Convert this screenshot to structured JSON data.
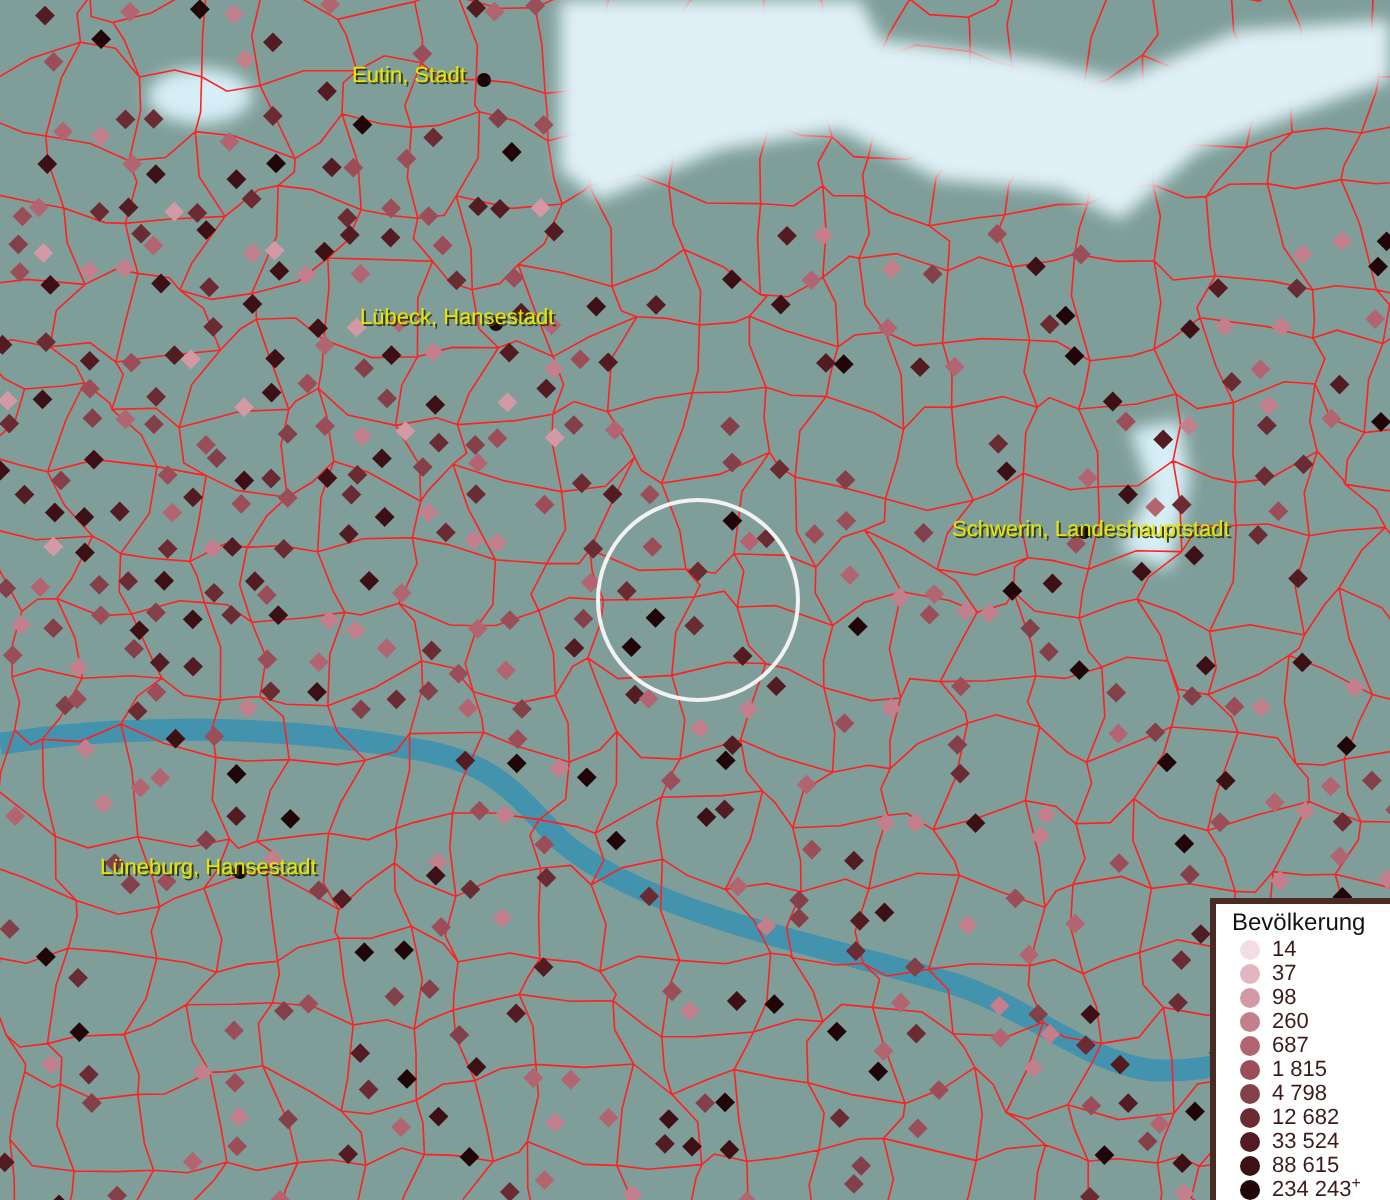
{
  "map": {
    "cities": [
      {
        "name": "Eutin, Stadt"
      },
      {
        "name": "Lübeck, Hansestadt"
      },
      {
        "name": "Schwerin, Landeshauptstadt"
      },
      {
        "name": "Lüneburg, Hansestadt"
      }
    ]
  },
  "legend": {
    "title": "Bevölkerung",
    "items": [
      {
        "label": "14",
        "color": "#f5dde6"
      },
      {
        "label": "37",
        "color": "#e3b7c2"
      },
      {
        "label": "98",
        "color": "#d39aa6"
      },
      {
        "label": "260",
        "color": "#c47f8c"
      },
      {
        "label": "687",
        "color": "#b26570"
      },
      {
        "label": "1 815",
        "color": "#9c4e58"
      },
      {
        "label": "4 798",
        "color": "#844049"
      },
      {
        "label": "12 682",
        "color": "#6b2b33"
      },
      {
        "label": "33 524",
        "color": "#531c23"
      },
      {
        "label": "88 615",
        "color": "#3d1015"
      },
      {
        "label": "234 243$^{+}$",
        "color": "#200608"
      }
    ]
  }
}
